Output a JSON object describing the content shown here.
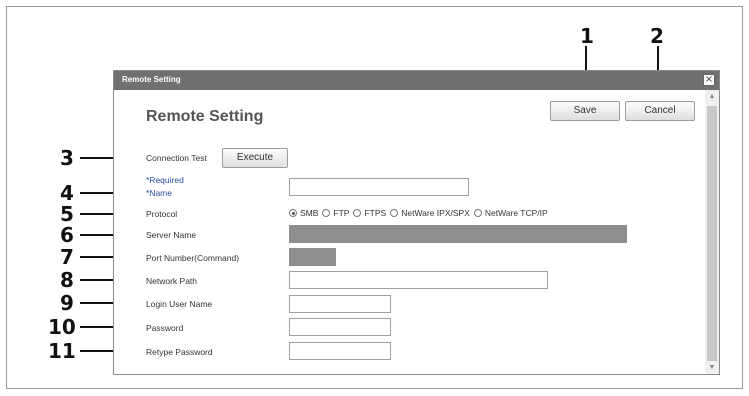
{
  "window": {
    "title": "Remote Setting",
    "close_glyph": "×"
  },
  "page": {
    "title": "Remote Setting"
  },
  "toolbar": {
    "save_label": "Save",
    "cancel_label": "Cancel"
  },
  "connection_test": {
    "label": "Connection Test",
    "button_label": "Execute"
  },
  "required_note": "*Required",
  "fields": {
    "name": {
      "label": "*Name",
      "value": ""
    },
    "protocol": {
      "label": "Protocol",
      "options": [
        "SMB",
        "FTP",
        "FTPS",
        "NetWare IPX/SPX",
        "NetWare TCP/IP"
      ],
      "selected": "SMB"
    },
    "server_name": {
      "label": "Server Name",
      "value": ""
    },
    "port_number": {
      "label": "Port Number(Command)",
      "value": ""
    },
    "network_path": {
      "label": "Network Path",
      "value": ""
    },
    "login_user_name": {
      "label": "Login User Name",
      "value": ""
    },
    "password": {
      "label": "Password",
      "value": ""
    },
    "retype_password": {
      "label": "Retype Password",
      "value": ""
    }
  },
  "callouts": [
    "1",
    "2",
    "3",
    "4",
    "5",
    "6",
    "7",
    "8",
    "9",
    "10",
    "11"
  ],
  "icons": {
    "close": "close-icon",
    "scroll_up": "scroll-up-icon",
    "scroll_down": "scroll-down-icon"
  }
}
